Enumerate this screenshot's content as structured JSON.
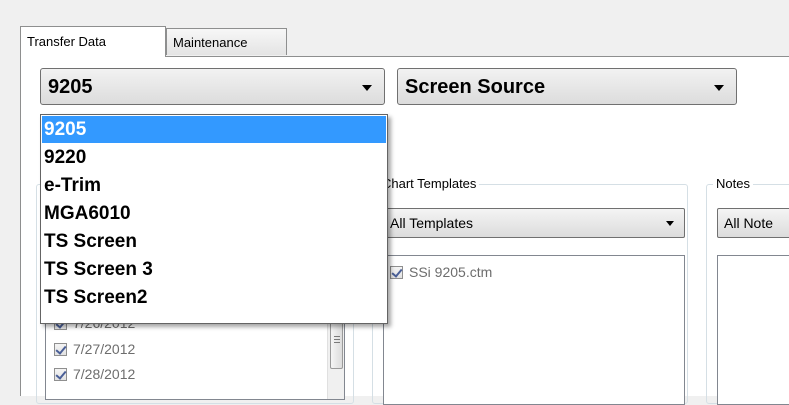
{
  "tabs": [
    {
      "label": "Transfer Data",
      "active": true
    },
    {
      "label": "Maintenance",
      "active": false
    }
  ],
  "device_combo": {
    "value": "9205"
  },
  "source_combo": {
    "value": "Screen Source"
  },
  "device_dropdown": {
    "options": [
      "9205",
      "9220",
      "e-Trim",
      "MGA6010",
      "TS Screen",
      "TS Screen 3",
      "TS Screen2"
    ],
    "selected_index": 0
  },
  "chart_templates": {
    "title": "Chart Templates",
    "filter": "All Templates",
    "items": [
      {
        "label": "SSi 9205.ctm",
        "checked": true
      }
    ]
  },
  "notes": {
    "title": "Notes",
    "filter": "All Note"
  },
  "dates": {
    "items": [
      {
        "label": "7/26/2012",
        "checked": true
      },
      {
        "label": "7/27/2012",
        "checked": true
      },
      {
        "label": "7/28/2012",
        "checked": true
      }
    ]
  },
  "colors": {
    "selection": "#3399ff",
    "panel_border": "#8e8f8f",
    "group_border": "#d5dfe5"
  }
}
